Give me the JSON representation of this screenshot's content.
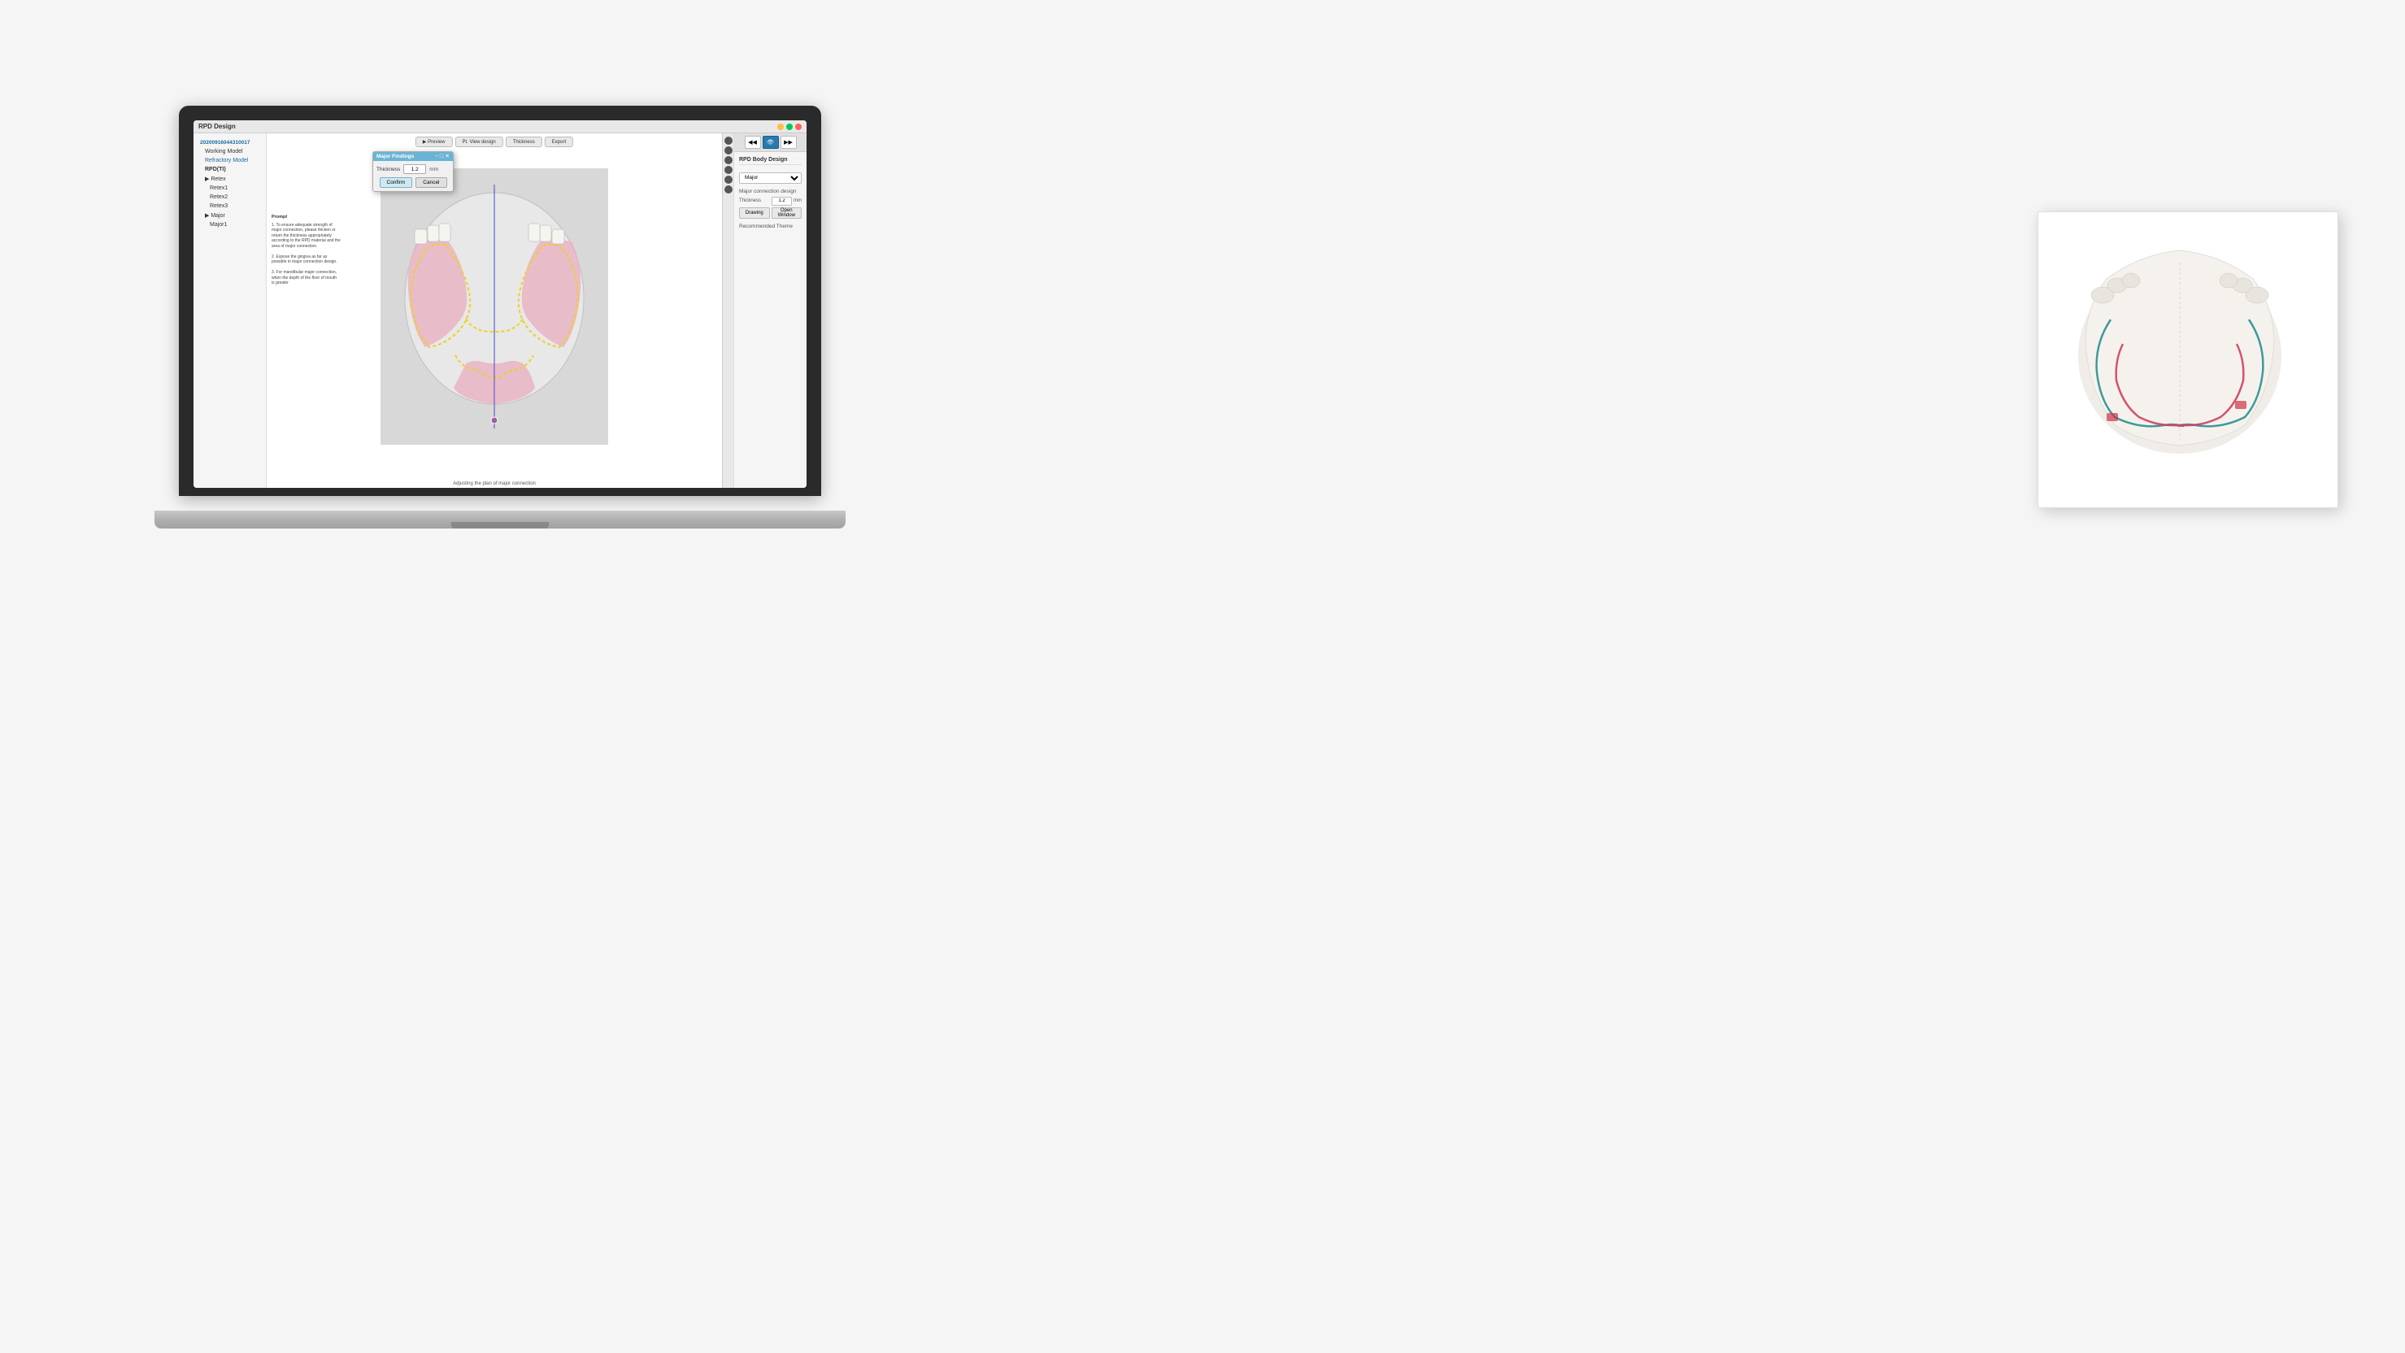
{
  "page": {
    "background_color": "#f5f5f5"
  },
  "app": {
    "title": "RPD Design",
    "window_controls": {
      "minimize": "—",
      "maximize": "□",
      "close": "✕"
    }
  },
  "sidebar": {
    "items": [
      {
        "label": "20200916044310017",
        "indent": 0,
        "active": false,
        "bold": false
      },
      {
        "label": "Working Model",
        "indent": 1,
        "active": false,
        "bold": false
      },
      {
        "label": "Refractory Model",
        "indent": 1,
        "active": true,
        "bold": false
      },
      {
        "label": "RPD(TI)",
        "indent": 1,
        "active": false,
        "bold": true
      },
      {
        "label": "▶ Retex",
        "indent": 1,
        "active": false,
        "bold": false
      },
      {
        "label": "Retex1",
        "indent": 2,
        "active": false,
        "bold": false
      },
      {
        "label": "Retex2",
        "indent": 2,
        "active": false,
        "bold": false
      },
      {
        "label": "Retex3",
        "indent": 2,
        "active": false,
        "bold": false
      },
      {
        "label": "▶ Major",
        "indent": 1,
        "active": false,
        "bold": false
      },
      {
        "label": "Major1",
        "indent": 2,
        "active": false,
        "bold": false
      }
    ]
  },
  "toolbar": {
    "buttons": [
      {
        "label": "▶ Preview",
        "active": false
      },
      {
        "label": "Pt. View design",
        "active": false
      },
      {
        "label": "Thickness",
        "active": false
      },
      {
        "label": "Export",
        "active": false
      }
    ]
  },
  "dialog": {
    "title": "Major Findings",
    "thickness_label": "Thickness",
    "thickness_value": "1.2",
    "thickness_unit": "mm",
    "confirm_label": "Confirm",
    "cancel_label": "Cancel"
  },
  "prompt": {
    "title": "Prompt",
    "lines": [
      "1. To ensure adequate strength of major connection, please thicken or return the thickness appropriately according to the RPD material and the area of major connection.",
      "2. Expose the gingiva as far as possible in major connection design.",
      "3. For mandibular major connection, when the depth of the floor of mouth is greater"
    ]
  },
  "status_bar": {
    "text": "Adjusting the plan of major connection"
  },
  "right_toolbar": {
    "buttons": [
      {
        "label": "◀◀",
        "active": false
      },
      {
        "label": "👁",
        "active": true
      },
      {
        "label": "▶▶",
        "active": false
      }
    ]
  },
  "rpd_panel": {
    "title": "RPD Body Design",
    "connection_section": {
      "label": "Major",
      "options": [
        "Major"
      ]
    },
    "connection_design": {
      "title": "Major connection design",
      "thickness_label": "Thickness",
      "thickness_value": "1.2",
      "thickness_unit": "mm",
      "drawing_btn": "Drawing",
      "open_window_btn": "Open Window"
    },
    "recommended_theme": {
      "label": "Recommended Theme"
    }
  }
}
